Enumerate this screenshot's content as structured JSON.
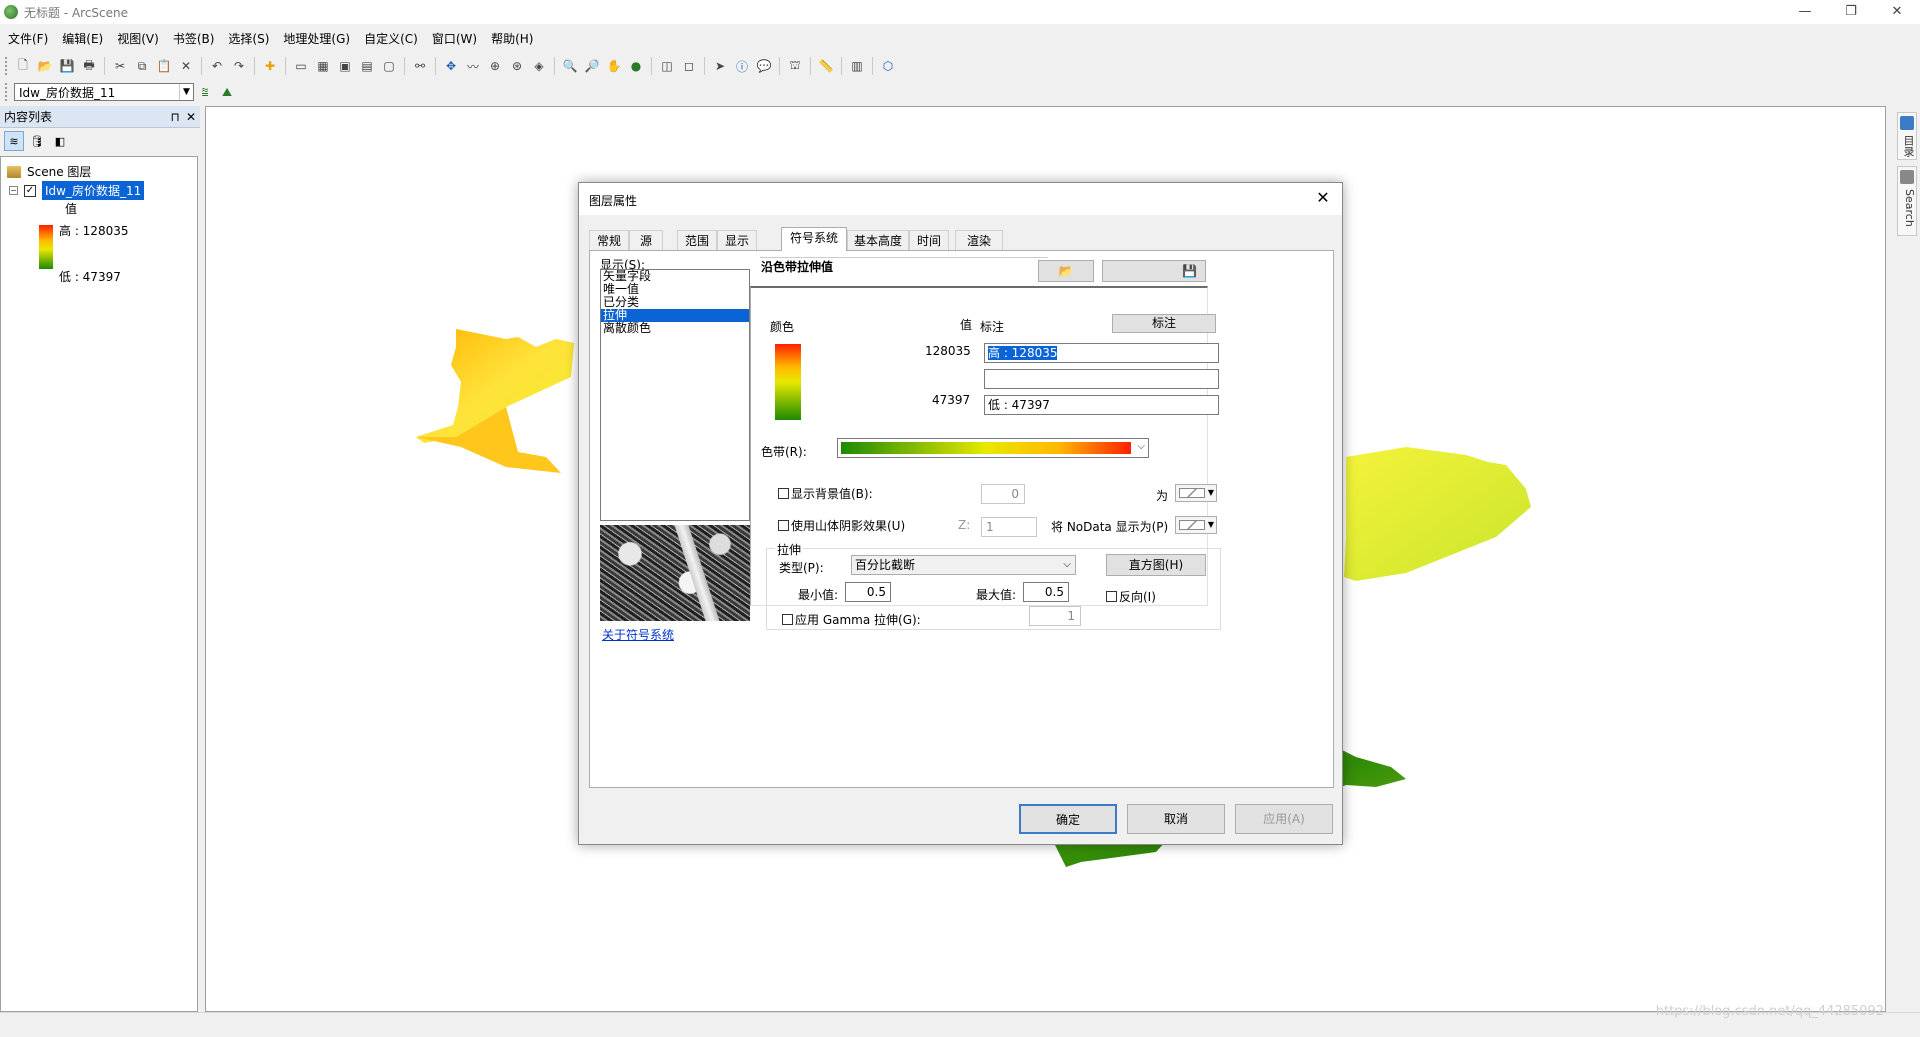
{
  "window": {
    "title": "无标题 - ArcScene",
    "minimize": "—",
    "restore": "❐",
    "close": "✕"
  },
  "menu": [
    "文件(F)",
    "编辑(E)",
    "视图(V)",
    "书签(B)",
    "选择(S)",
    "地理处理(G)",
    "自定义(C)",
    "窗口(W)",
    "帮助(H)"
  ],
  "toolbar2": {
    "layer_combo": "Idw_房价数据_11"
  },
  "toc": {
    "title": "内容列表",
    "pin": "⊓",
    "close": "✕",
    "scene_layers": "Scene 图层",
    "layer_name": "Idw_房价数据_11",
    "field": "值",
    "high": "高 : 128035",
    "low": "低 : 47397"
  },
  "dock": {
    "tab1": "目录",
    "tab2": "Search"
  },
  "watermark": "https://blog.csdn.net/qq_44285092",
  "dialog": {
    "title": "图层属性",
    "close": "✕",
    "tabs": [
      "常规",
      "源",
      "范围",
      "显示",
      "符号系统",
      "基本高度",
      "时间",
      "渲染"
    ],
    "selected_tab": "符号系统",
    "show_label": "显示(S):",
    "show_items": [
      "矢量字段",
      "唯一值",
      "已分类",
      "拉伸",
      "离散颜色"
    ],
    "selected_show_item": "拉伸",
    "about_link": "关于符号系统",
    "symb_title": "沿色带拉伸值",
    "open_btn": "📂",
    "save_btn": "💾",
    "col_color": "颜色",
    "col_value": "值",
    "col_label": "标注",
    "label_btn": "标注",
    "high_value": "128035",
    "high_label": "高 : 128035",
    "mid_label": "",
    "low_value": "47397",
    "low_label": "低 : 47397",
    "colorband_label": "色带(R):",
    "show_background": "显示背景值(B):",
    "background_value": "0",
    "as_label": "为",
    "hillshade": "使用山体阴影效果(U)",
    "z_label": "Z:",
    "z_value": "1",
    "nodata_label": "将 NoData 显示为(P)",
    "stretch_group": "拉伸",
    "type_label": "类型(P):",
    "type_value": "百分比截断",
    "histogram_btn": "直方图(H)",
    "min_label": "最小值:",
    "min_value": "0.5",
    "max_label": "最大值:",
    "max_value": "0.5",
    "invert": "反向(I)",
    "gamma": "应用 Gamma 拉伸(G):",
    "gamma_value": "1",
    "ok": "确定",
    "cancel": "取消",
    "apply": "应用(A)"
  },
  "colors": {
    "ramp_high": "#ff1f00",
    "ramp_mid": "#e8e800",
    "ramp_low": "#1e8a00",
    "selection": "#0a64d6"
  }
}
